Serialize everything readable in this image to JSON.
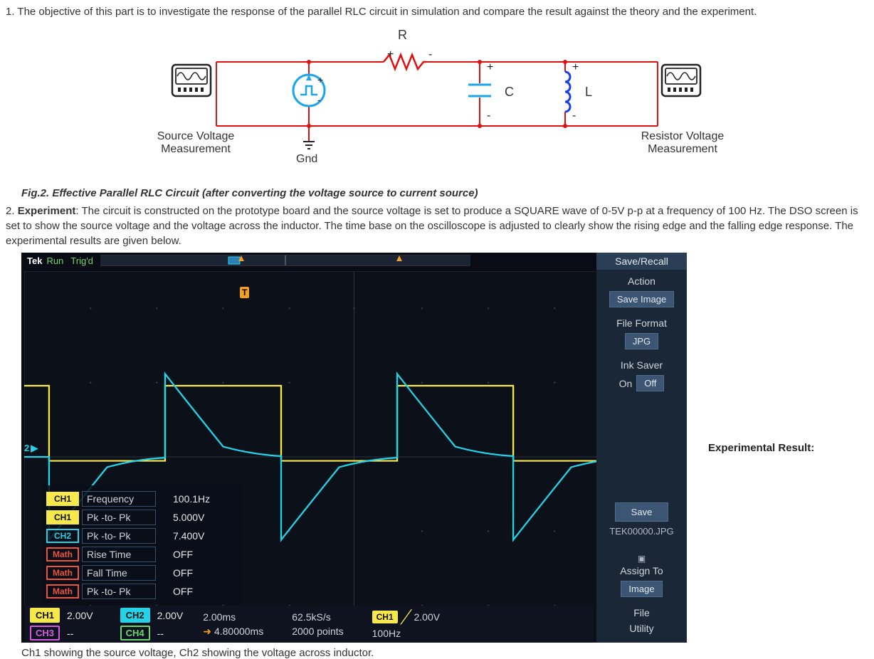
{
  "item1_text": "1. The objective of this part is to investigate the response of the parallel RLC circuit in simulation and compare the result against the theory and the experiment.",
  "circuit": {
    "r_label": "R",
    "c_label": "C",
    "l_label": "L",
    "gnd_label": "Gnd",
    "src_meas": "Source Voltage Measurement",
    "res_meas": "Resistor Voltage Measurement"
  },
  "fig_caption": "Fig.2. Effective Parallel RLC Circuit (after converting the voltage source to current source)",
  "item2_prefix": "2. ",
  "item2_strong": "Experiment",
  "item2_text": ": The circuit is constructed on the prototype board and the source voltage is set to produce a SQUARE wave of 0-5V p-p at a frequency of 100 Hz. The DSO screen is set to show the source voltage and the voltage across the inductor. The time base on the oscilloscope is adjusted to clearly show the rising edge and the falling edge response. The experimental results are given below.",
  "scope": {
    "tek": "Tek",
    "run": "Run",
    "trigd": "Trig'd",
    "t_label": "T",
    "ch_arrow": "2",
    "readouts": [
      {
        "tag": "CH1",
        "cls": "tag-ch1",
        "label": "Frequency",
        "val": "100.1Hz"
      },
      {
        "tag": "CH1",
        "cls": "tag-ch1",
        "label": "Pk -to- Pk",
        "val": "5.000V"
      },
      {
        "tag": "CH2",
        "cls": "tag-ch2b",
        "label": "Pk -to- Pk",
        "val": "7.400V"
      },
      {
        "tag": "Math",
        "cls": "tag-math",
        "label": "Rise Time",
        "val": "OFF"
      },
      {
        "tag": "Math",
        "cls": "tag-math",
        "label": "Fall Time",
        "val": "OFF"
      },
      {
        "tag": "Math",
        "cls": "tag-math",
        "label": "Pk -to- Pk",
        "val": "OFF"
      }
    ],
    "bottom": {
      "ch1": {
        "name": "CH1",
        "val": "2.00V"
      },
      "ch2": {
        "name": "CH2",
        "val": "2.00V"
      },
      "ch3": {
        "name": "CH3",
        "val": "--"
      },
      "ch4": {
        "name": "CH4",
        "val": "--"
      },
      "timebase": "2.00ms",
      "delay": "4.80000ms",
      "srate": "62.5kS/s",
      "points": "2000 points",
      "trig_ch": "CH1",
      "trig_level": "2.00V",
      "trig_freq": "100Hz"
    },
    "menu": {
      "title": "Save/Recall",
      "action": "Action",
      "action_btn": "Save Image",
      "format": "File Format",
      "format_btn": "JPG",
      "ink": "Ink Saver",
      "ink_on": "On",
      "ink_off": "Off",
      "save": "Save",
      "file": "TEK00000.JPG",
      "assign": "Assign To",
      "assign_btn": "Image",
      "file_lbl": "File",
      "util": "Utility"
    }
  },
  "exp_result_label": "Experimental Result:",
  "foot_note": "Ch1 showing the source voltage, Ch2 showing the voltage across inductor."
}
